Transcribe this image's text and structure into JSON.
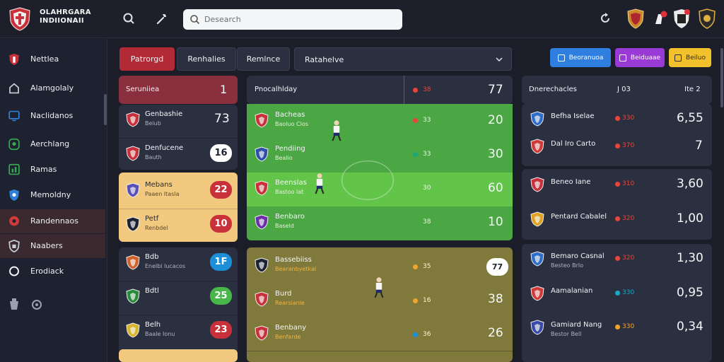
{
  "brand": {
    "line1": "OLAHRGARA",
    "line2": "INDIIONAII"
  },
  "search": {
    "placeholder": "Desearch"
  },
  "sidebar": {
    "items": [
      {
        "label": "Nettlea",
        "icon": "shield-icon",
        "color": "#c8303a"
      },
      {
        "label": "Alamgolaly",
        "icon": "building-icon",
        "color": "#c9ced8"
      },
      {
        "label": "Naclidanos",
        "icon": "monitor-icon",
        "color": "#2d7fd8"
      },
      {
        "label": "Aerchlang",
        "icon": "badge-icon",
        "color": "#35a853"
      },
      {
        "label": "Ramas",
        "icon": "chart-icon",
        "color": "#35a853"
      },
      {
        "label": "Memoldny",
        "icon": "crest-icon",
        "color": "#2d7fd8"
      },
      {
        "label": "Randennaos",
        "icon": "ball-icon",
        "color": "#d23a3a"
      },
      {
        "label": "Naabers",
        "icon": "shield-outline-icon",
        "color": "#c9ced8"
      },
      {
        "label": "Erodiack",
        "icon": "circle-icon",
        "color": "#ffffff"
      }
    ]
  },
  "tabs": [
    "Patrorgd",
    "Renhalies",
    "Remlnce"
  ],
  "dropdown": {
    "value": "Ratahelve"
  },
  "actions": [
    {
      "label": "Beoranuoa",
      "color": "#2f7fe0"
    },
    {
      "label": "Beiduaae",
      "color": "#9a3ad6"
    },
    {
      "label": "Beiluo",
      "color": "#f2c12b"
    }
  ],
  "left": {
    "header": {
      "title": "Seruniiea",
      "value": "1"
    },
    "groups": [
      {
        "bg": "#2b3041",
        "rows": [
          {
            "name": "Genbashie",
            "sub": "Beiub",
            "value": "73",
            "style": "plain",
            "crest": "#c8303a"
          },
          {
            "name": "Denfucene",
            "sub": "Bauth",
            "value": "16",
            "style": "white",
            "crest": "#c8303a"
          }
        ]
      },
      {
        "bg": "#f2c97e",
        "rows": [
          {
            "name": "Mebans",
            "sub": "Paaen Itasla",
            "value": "22",
            "style": "red",
            "crest": "#5a4fb5"
          },
          {
            "name": "Petf",
            "sub": "Renbdel",
            "value": "10",
            "style": "red",
            "crest": "#1d2233"
          }
        ]
      },
      {
        "bg": "#2b3041",
        "rows": [
          {
            "name": "Bdb",
            "sub": "Enelbi lucacos",
            "value": "1F",
            "style": "blue",
            "crest": "#d2622c"
          },
          {
            "name": "Bdtl",
            "sub": "",
            "value": "25",
            "style": "green",
            "crest": "#2a8a3c"
          },
          {
            "name": "Belh",
            "sub": "Baale Ionu",
            "value": "23",
            "style": "red",
            "crest": "#d8b52a"
          }
        ]
      }
    ]
  },
  "mid": {
    "header": {
      "title": "Pnocalhlday",
      "badge": "38",
      "value": "77"
    },
    "green": [
      {
        "name": "Bacheas",
        "sub": "Baoluo Clos",
        "dot": "33",
        "value": "20"
      },
      {
        "name": "Pendiing",
        "sub": "Bealio",
        "dot": "33",
        "value": "30"
      },
      {
        "name": "Beenslas",
        "sub": "Bastoo lat",
        "dot": "30",
        "value": "60"
      },
      {
        "name": "Benbaro",
        "sub": "Baseld",
        "dot": "38",
        "value": "10"
      }
    ],
    "olive": [
      {
        "name": "Bassebiiss",
        "sub": "Bearanbyetkal",
        "dot": "35",
        "value": "77",
        "style": "white"
      },
      {
        "name": "Burd",
        "sub": "Rearsianle",
        "dot": "16",
        "value": "38"
      },
      {
        "name": "Benbany",
        "sub": "Benfarde",
        "dot": "36",
        "value": "26"
      }
    ]
  },
  "right": {
    "header": {
      "title": "Dnerechacles",
      "col1": "J 03",
      "col2": "Ite 2"
    },
    "rows": [
      {
        "name": "Befha Iselae",
        "sub": "",
        "dot": "330",
        "dcolor": "#e8453a",
        "value": "6,55",
        "crest": "#2d6ec9"
      },
      {
        "name": "Dal Iro Carto",
        "sub": "",
        "dot": "370",
        "dcolor": "#e8453a",
        "value": "7",
        "crest": "#d23a3a"
      },
      {
        "name": "Beneo Iane",
        "sub": "",
        "dot": "310",
        "dcolor": "#e8453a",
        "value": "3,60",
        "crest": "#c8303a"
      },
      {
        "name": "Pentard Cabalel",
        "sub": "",
        "dot": "320",
        "dcolor": "#e8453a",
        "value": "1,00",
        "crest": "#e0a020"
      },
      {
        "name": "Bemaro Casnal",
        "sub": "Besteo Brlo",
        "dot": "320",
        "dcolor": "#e8453a",
        "value": "1,30",
        "crest": "#2d6ec9"
      },
      {
        "name": "Aamalanian",
        "sub": "",
        "dot": "330",
        "dcolor": "#1aa7c8",
        "value": "0,95",
        "crest": "#d23a3a"
      },
      {
        "name": "Gamiard Nang",
        "sub": "Bestor Bell",
        "dot": "330",
        "dcolor": "#f2a52b",
        "value": "0,34",
        "crest": "#3a4aa8"
      }
    ]
  },
  "colors": {
    "accent": "#b22a35",
    "green": "#4caf4a",
    "olive": "#7f7a3c",
    "panel": "#2b3041"
  }
}
